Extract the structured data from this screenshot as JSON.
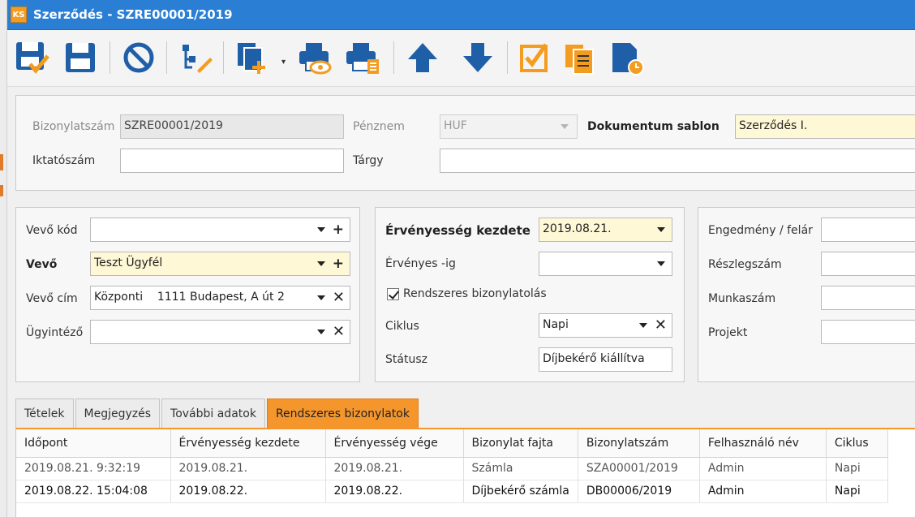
{
  "window": {
    "title": "Szerződés - SZRE00001/2019",
    "app_badge": "KS"
  },
  "toolbar": {
    "buttons": [
      {
        "icon": "save-and-approve-icon"
      },
      {
        "icon": "save-icon"
      },
      {
        "icon": "cancel-icon"
      },
      {
        "icon": "hierarchy-edit-icon"
      },
      {
        "icon": "copy-new-icon"
      },
      {
        "icon": "print-preview-icon"
      },
      {
        "icon": "print-list-icon"
      },
      {
        "icon": "arrow-up-icon"
      },
      {
        "icon": "arrow-down-icon"
      },
      {
        "icon": "checklist-icon"
      },
      {
        "icon": "documents-icon"
      },
      {
        "icon": "scheduled-document-icon"
      }
    ]
  },
  "header": {
    "doc_number_label": "Bizonylatszám",
    "doc_number_value": "SZRE00001/2019",
    "currency_label": "Pénznem",
    "currency_value": "HUF",
    "template_label": "Dokumentum sablon",
    "template_value": "Szerződés I.",
    "filing_label": "Iktatószám",
    "filing_value": "",
    "subject_label": "Tárgy",
    "subject_value": ""
  },
  "customer": {
    "code_label": "Vevő kód",
    "code_value": "",
    "name_label": "Vevő",
    "name_value": "Teszt Ügyfél",
    "address_label": "Vevő cím",
    "address_value": "Központi    1111 Budapest, A út 2",
    "agent_label": "Ügyintéző",
    "agent_value": ""
  },
  "validity": {
    "start_label": "Érvényesség kezdete",
    "start_value": "2019.08.21.",
    "end_label": "Érvényes -ig",
    "end_value": "",
    "recurring_label": "Rendszeres bizonylatolás",
    "recurring_checked": true,
    "cycle_label": "Ciklus",
    "cycle_value": "Napi",
    "status_label": "Státusz",
    "status_value": "Díjbekérő kiállítva"
  },
  "extra": {
    "discount_label": "Engedmény / felár",
    "installment_label": "Részlegszám",
    "worknumber_label": "Munkaszám",
    "project_label": "Projekt"
  },
  "tabs": [
    {
      "label": "Tételek",
      "active": false
    },
    {
      "label": "Megjegyzés",
      "active": false
    },
    {
      "label": "További adatok",
      "active": false
    },
    {
      "label": "Rendszeres bizonylatok",
      "active": true
    }
  ],
  "grid": {
    "columns": [
      "Időpont",
      "Érvényesség kezdete",
      "Érvényesség vége",
      "Bizonylat fajta",
      "Bizonylatszám",
      "Felhasználó név",
      "Ciklus"
    ],
    "rows": [
      [
        "2019.08.21. 9:32:19",
        "2019.08.21.",
        "2019.08.21.",
        "Számla",
        "SZA00001/2019",
        "Admin",
        "Napi"
      ],
      [
        "2019.08.22. 15:04:08",
        "2019.08.22.",
        "2019.08.22.",
        "Díjbekérő számla",
        "DB00006/2019",
        "Admin",
        "Napi"
      ]
    ]
  },
  "colors": {
    "titlebar": "#2a7fd4",
    "accent_orange": "#f5962d",
    "icon_blue": "#1f5fa8"
  }
}
